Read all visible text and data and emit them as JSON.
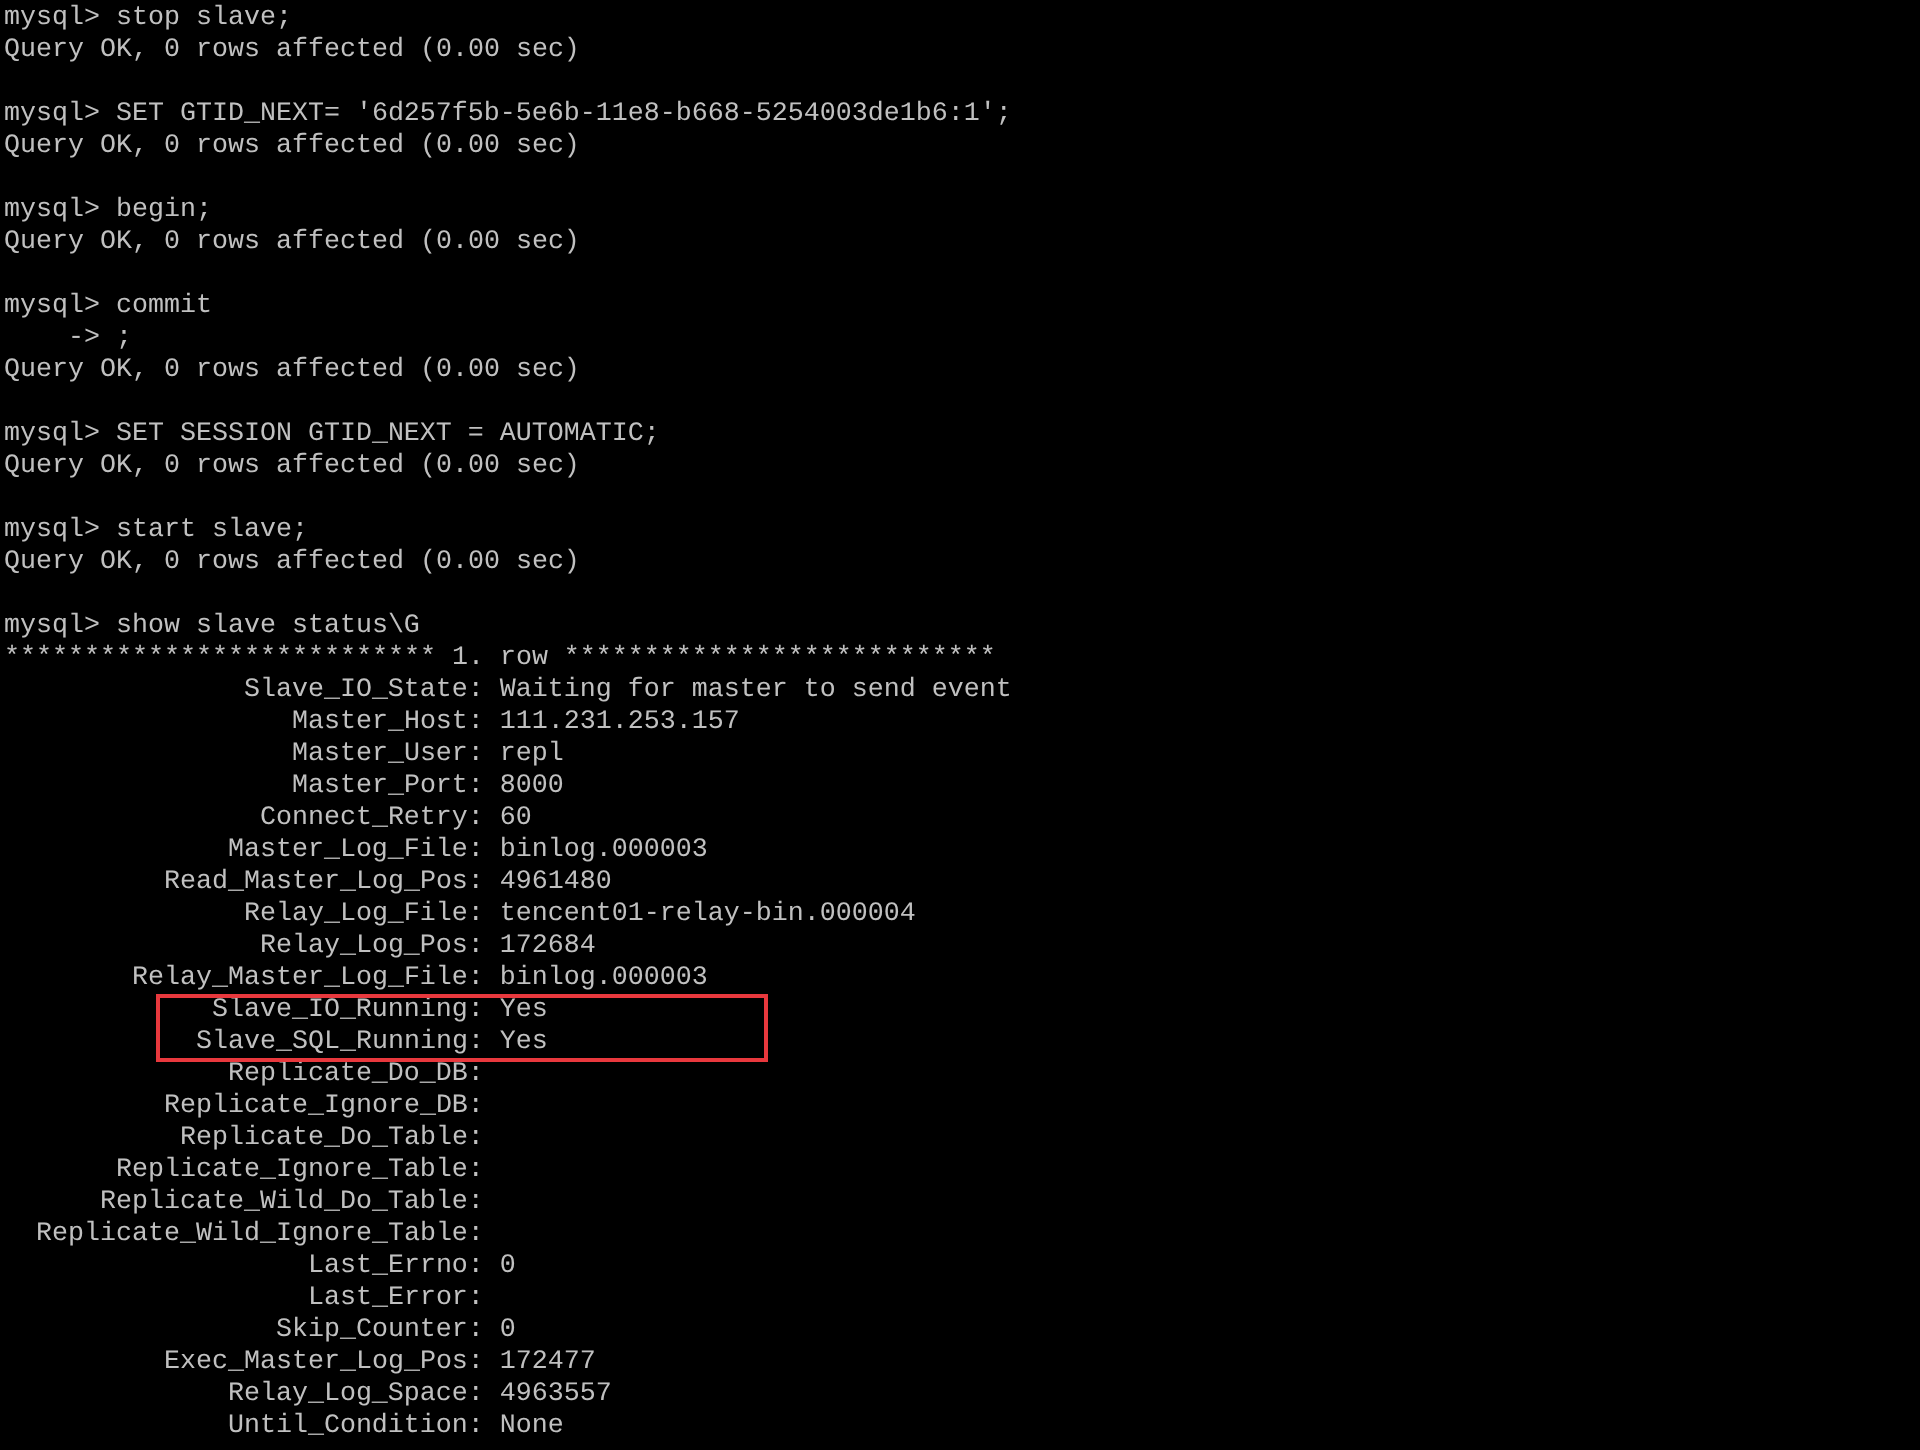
{
  "session": [
    {
      "kind": "input",
      "prompt": "mysql>",
      "text": "stop slave;"
    },
    {
      "kind": "output",
      "text": "Query OK, 0 rows affected (0.00 sec)"
    },
    {
      "kind": "blank"
    },
    {
      "kind": "input",
      "prompt": "mysql>",
      "text": "SET GTID_NEXT= '6d257f5b-5e6b-11e8-b668-5254003de1b6:1';"
    },
    {
      "kind": "output",
      "text": "Query OK, 0 rows affected (0.00 sec)"
    },
    {
      "kind": "blank"
    },
    {
      "kind": "input",
      "prompt": "mysql>",
      "text": "begin;"
    },
    {
      "kind": "output",
      "text": "Query OK, 0 rows affected (0.00 sec)"
    },
    {
      "kind": "blank"
    },
    {
      "kind": "input",
      "prompt": "mysql>",
      "text": "commit"
    },
    {
      "kind": "input",
      "prompt": "->",
      "text": ";"
    },
    {
      "kind": "output",
      "text": "Query OK, 0 rows affected (0.00 sec)"
    },
    {
      "kind": "blank"
    },
    {
      "kind": "input",
      "prompt": "mysql>",
      "text": "SET SESSION GTID_NEXT = AUTOMATIC;"
    },
    {
      "kind": "output",
      "text": "Query OK, 0 rows affected (0.00 sec)"
    },
    {
      "kind": "blank"
    },
    {
      "kind": "input",
      "prompt": "mysql>",
      "text": "start slave;"
    },
    {
      "kind": "output",
      "text": "Query OK, 0 rows affected (0.00 sec)"
    },
    {
      "kind": "blank"
    },
    {
      "kind": "input",
      "prompt": "mysql>",
      "text": "show slave status\\G"
    },
    {
      "kind": "output",
      "text": "*************************** 1. row ***************************"
    }
  ],
  "status_fields": [
    {
      "name": "Slave_IO_State:",
      "value": "Waiting for master to send event",
      "highlighted": false
    },
    {
      "name": "Master_Host:",
      "value": "111.231.253.157",
      "highlighted": false
    },
    {
      "name": "Master_User:",
      "value": "repl",
      "highlighted": false
    },
    {
      "name": "Master_Port:",
      "value": "8000",
      "highlighted": false
    },
    {
      "name": "Connect_Retry:",
      "value": "60",
      "highlighted": false
    },
    {
      "name": "Master_Log_File:",
      "value": "binlog.000003",
      "highlighted": false
    },
    {
      "name": "Read_Master_Log_Pos:",
      "value": "4961480",
      "highlighted": false
    },
    {
      "name": "Relay_Log_File:",
      "value": "tencent01-relay-bin.000004",
      "highlighted": false
    },
    {
      "name": "Relay_Log_Pos:",
      "value": "172684",
      "highlighted": false
    },
    {
      "name": "Relay_Master_Log_File:",
      "value": "binlog.000003",
      "highlighted": false
    },
    {
      "name": "Slave_IO_Running:",
      "value": "Yes",
      "highlighted": true
    },
    {
      "name": "Slave_SQL_Running:",
      "value": "Yes",
      "highlighted": true
    },
    {
      "name": "Replicate_Do_DB:",
      "highlighted": false
    },
    {
      "name": "Replicate_Ignore_DB:",
      "highlighted": false
    },
    {
      "name": "Replicate_Do_Table:",
      "highlighted": false
    },
    {
      "name": "Replicate_Ignore_Table:",
      "highlighted": false
    },
    {
      "name": "Replicate_Wild_Do_Table:",
      "highlighted": false
    },
    {
      "name": "Replicate_Wild_Ignore_Table:",
      "highlighted": false
    },
    {
      "name": "Last_Errno:",
      "value": "0",
      "highlighted": false
    },
    {
      "name": "Last_Error:",
      "highlighted": false
    },
    {
      "name": "Skip_Counter:",
      "value": "0",
      "highlighted": false
    },
    {
      "name": "Exec_Master_Log_Pos:",
      "value": "172477",
      "highlighted": false
    },
    {
      "name": "Relay_Log_Space:",
      "value": "4963557",
      "highlighted": false
    },
    {
      "name": "Until_Condition:",
      "value": "None",
      "highlighted": false
    }
  ]
}
